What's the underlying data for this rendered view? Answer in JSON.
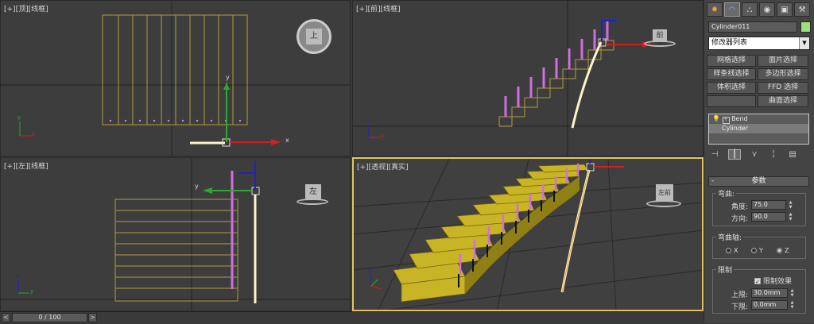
{
  "viewports": {
    "top": {
      "label": "[+][顶][线框]",
      "cube": "上"
    },
    "front": {
      "label": "[+][前][线框]",
      "cube": "前"
    },
    "left": {
      "label": "[+][左][线框]",
      "cube": "左"
    },
    "perspective": {
      "label": "[+][透视][真实]",
      "cube": "左前"
    }
  },
  "axis": {
    "x": "x",
    "y": "y",
    "z": "z"
  },
  "panel": {
    "tabs": [
      "create-icon",
      "modify-icon",
      "hierarchy-icon",
      "motion-icon",
      "display-icon",
      "utilities-icon"
    ],
    "object_name": "Cylinder011",
    "object_color": "#9be07a",
    "modifier_list": "修改器列表",
    "selection_buttons": [
      [
        "网格选择",
        "面片选择"
      ],
      [
        "样条线选择",
        "多边形选择"
      ],
      [
        "体积选择",
        "FFD 选择"
      ],
      [
        "",
        "曲面选择"
      ]
    ],
    "stack": [
      {
        "label": "Bend",
        "selected": false
      },
      {
        "label": "Cylinder",
        "selected": true
      }
    ],
    "params": {
      "header": "参数",
      "bend_group": "弯曲:",
      "angle_label": "角度:",
      "angle": "75.0",
      "direction_label": "方向:",
      "direction": "90.0",
      "axis_group": "弯曲轴:",
      "axes": [
        "X",
        "Y",
        "Z"
      ],
      "selected_axis": "Z",
      "limits_group": "限制",
      "limit_effect": "限制效果",
      "upper_label": "上限:",
      "upper": "30.0mm",
      "lower_label": "下限:",
      "lower": "0.0mm"
    }
  },
  "timeline": {
    "prev": "<",
    "position": "0 / 100",
    "next": ">"
  }
}
